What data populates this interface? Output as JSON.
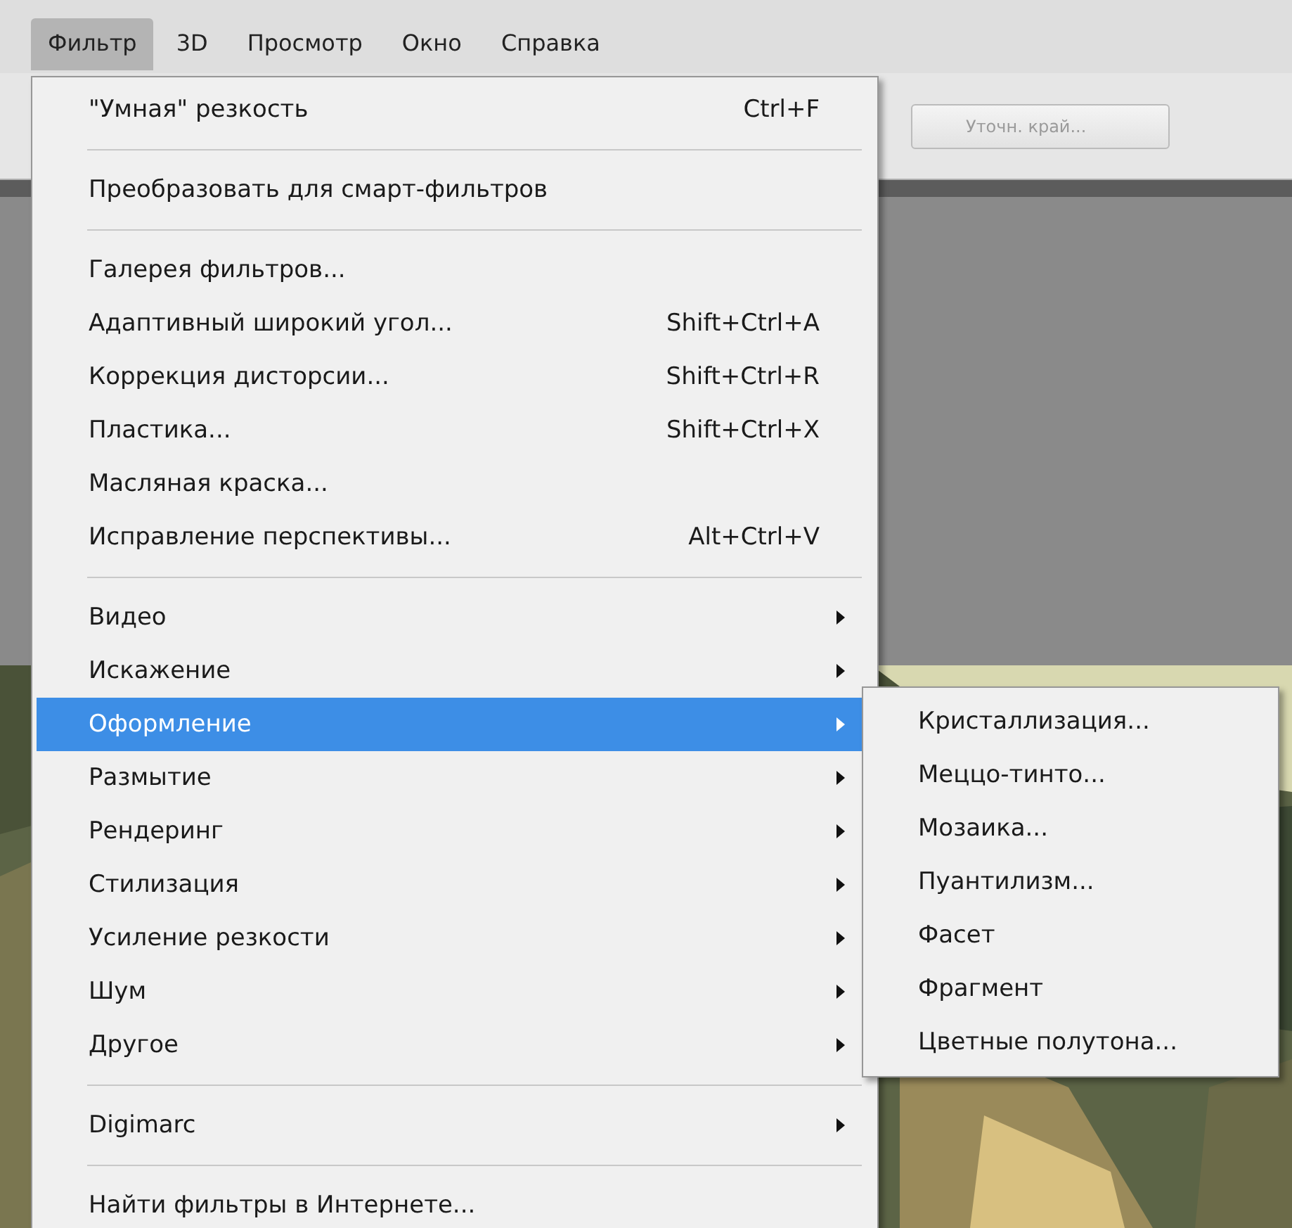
{
  "menubar": [
    {
      "label": "Фильтр",
      "selected": true
    },
    {
      "label": "3D",
      "selected": false
    },
    {
      "label": "Просмотр",
      "selected": false
    },
    {
      "label": "Окно",
      "selected": false
    },
    {
      "label": "Справка",
      "selected": false
    }
  ],
  "options_bar": {
    "button": {
      "label": "Уточн. край...",
      "disabled": true
    }
  },
  "menu": {
    "sections": [
      [
        {
          "label": "\"Умная\" резкость",
          "shortcut": "Ctrl+F",
          "submenu": false,
          "selected": false
        }
      ],
      [
        {
          "label": "Преобразовать для смарт-фильтров",
          "submenu": false,
          "selected": false
        }
      ],
      [
        {
          "label": "Галерея фильтров...",
          "submenu": false,
          "selected": false
        },
        {
          "label": "Адаптивный широкий угол...",
          "shortcut": "Shift+Ctrl+A",
          "submenu": false,
          "selected": false
        },
        {
          "label": "Коррекция дисторсии...",
          "shortcut": "Shift+Ctrl+R",
          "submenu": false,
          "selected": false
        },
        {
          "label": "Пластика...",
          "shortcut": "Shift+Ctrl+X",
          "submenu": false,
          "selected": false
        },
        {
          "label": "Масляная краска...",
          "submenu": false,
          "selected": false
        },
        {
          "label": "Исправление перспективы...",
          "shortcut": "Alt+Ctrl+V",
          "submenu": false,
          "selected": false
        }
      ],
      [
        {
          "label": "Видео",
          "submenu": true,
          "selected": false
        },
        {
          "label": "Искажение",
          "submenu": true,
          "selected": false
        },
        {
          "label": "Оформление",
          "submenu": true,
          "selected": true
        },
        {
          "label": "Размытие",
          "submenu": true,
          "selected": false
        },
        {
          "label": "Рендеринг",
          "submenu": true,
          "selected": false
        },
        {
          "label": "Стилизация",
          "submenu": true,
          "selected": false
        },
        {
          "label": "Усиление резкости",
          "submenu": true,
          "selected": false
        },
        {
          "label": "Шум",
          "submenu": true,
          "selected": false
        },
        {
          "label": "Другое",
          "submenu": true,
          "selected": false
        }
      ],
      [
        {
          "label": "Digimarc",
          "submenu": true,
          "selected": false
        }
      ],
      [
        {
          "label": "Найти фильтры в Интернете...",
          "submenu": false,
          "selected": false
        }
      ]
    ]
  },
  "submenu": {
    "items": [
      "Кристаллизация...",
      "Меццо-тинто...",
      "Мозаика...",
      "Пуантилизм...",
      "Фасет",
      "Фрагмент",
      "Цветные полутона..."
    ]
  }
}
